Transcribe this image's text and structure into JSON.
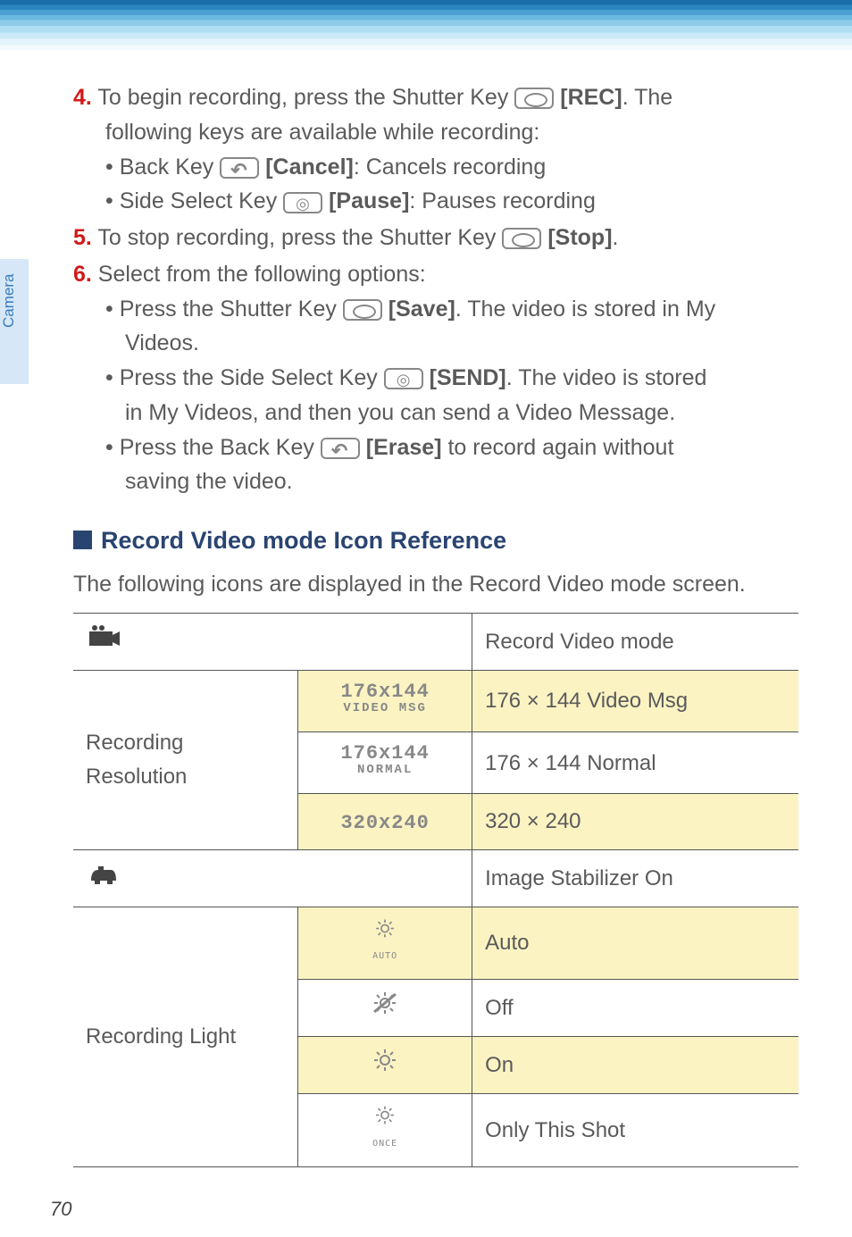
{
  "sideTab": "Camera",
  "steps": {
    "s4": {
      "num": "4.",
      "pre": " To begin recording, press the Shutter Key ",
      "key": "[REC]",
      "post": ". The",
      "line2": "following keys are available while recording:",
      "b1pre": "Back Key ",
      "b1key": "[Cancel]",
      "b1post": ": Cancels recording",
      "b2pre": "Side Select Key ",
      "b2key": "[Pause]",
      "b2post": ": Pauses recording"
    },
    "s5": {
      "num": "5.",
      "pre": " To stop recording, press the Shutter Key ",
      "key": "[Stop]",
      "post": "."
    },
    "s6": {
      "num": "6.",
      "text": " Select from the following options:",
      "b1pre": "Press the Shutter Key ",
      "b1key": "[Save]",
      "b1post": ". The video is stored in My",
      "b1cont": "Videos.",
      "b2pre": "Press the Side Select Key ",
      "b2key": "[SEND]",
      "b2post": ". The video is stored",
      "b2cont": "in My Videos, and then you can send a Video Message.",
      "b3pre": "Press the Back Key ",
      "b3key": "[Erase]",
      "b3post": " to record again without",
      "b3cont": "saving the video."
    }
  },
  "section": {
    "title": "Record Video mode Icon Reference",
    "intro": "The following icons are displayed in the Record Video mode screen."
  },
  "table": {
    "r1meaning": "Record Video mode",
    "resolutionLabel": "Recording Resolution",
    "res1big": "176x144",
    "res1small": "VIDEO MSG",
    "res1mean": "176 × 144 Video Msg",
    "res2big": "176x144",
    "res2small": "NORMAL",
    "res2mean": "176 × 144 Normal",
    "res3big": "320x240",
    "res3mean": "320 × 240",
    "stabMean": "Image Stabilizer On",
    "lightLabel": "Recording Light",
    "light1sub": "AUTO",
    "light1mean": "Auto",
    "light2mean": "Off",
    "light3mean": "On",
    "light4sub": "ONCE",
    "light4mean": "Only This Shot"
  },
  "pageNumber": "70"
}
